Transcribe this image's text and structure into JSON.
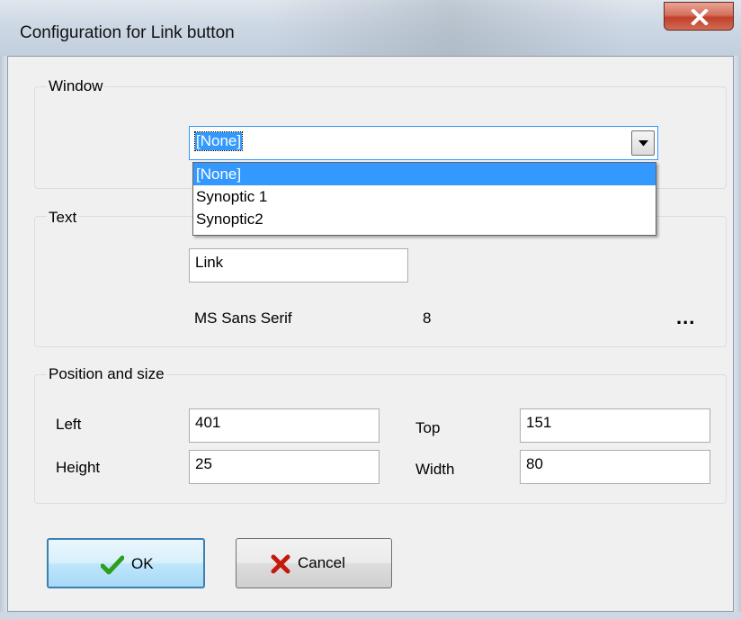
{
  "window": {
    "title": "Configuration for Link button",
    "close_icon": "close-icon"
  },
  "window_group": {
    "label": "Window",
    "combo_value": "[None]",
    "options": [
      "[None]",
      "Synoptic 1",
      "Synoptic2"
    ],
    "selected_option": "[None]"
  },
  "text_group": {
    "label": "Text",
    "text_value": "Link",
    "font_name": "MS Sans Serif",
    "font_size": "8",
    "font_button_label": "..."
  },
  "position_group": {
    "label": "Position and size",
    "left_label": "Left",
    "left_value": "401",
    "top_label": "Top",
    "top_value": "151",
    "height_label": "Height",
    "height_value": "25",
    "width_label": "Width",
    "width_value": "80"
  },
  "buttons": {
    "ok_label": "OK",
    "ok_icon": "checkmark-icon",
    "cancel_label": "Cancel",
    "cancel_icon": "x-icon"
  },
  "colors": {
    "selection": "#3399ff",
    "close_button": "#c2402a",
    "ok_check": "#2f9e1d",
    "cancel_x": "#c41a0c"
  }
}
